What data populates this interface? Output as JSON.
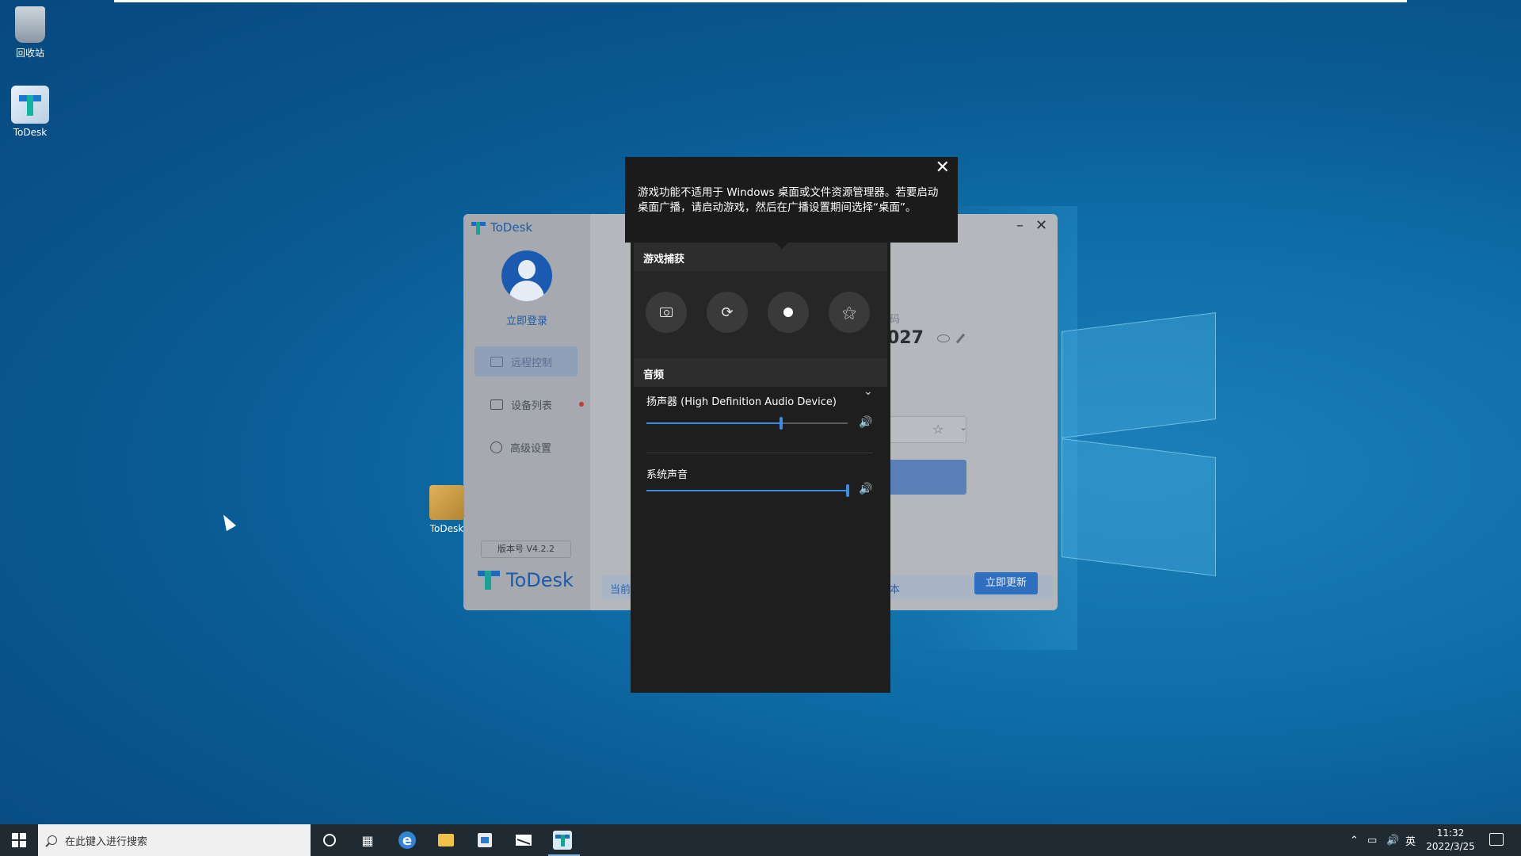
{
  "desktop": {
    "icons": [
      {
        "label": "回收站"
      },
      {
        "label": "ToDesk"
      },
      {
        "label": "ToDesk"
      }
    ]
  },
  "todesk": {
    "app_title": "ToDesk",
    "login_label": "立即登录",
    "nav": [
      {
        "label": "远程控制"
      },
      {
        "label": "设备列表"
      },
      {
        "label": "高级设置"
      }
    ],
    "version_label": "版本号 V4.2.2",
    "brand_label": "ToDesk",
    "code_label": "码",
    "device_code_fragment": "027",
    "update_left": "当前",
    "update_right": "本",
    "update_button": "立即更新"
  },
  "tooltip": {
    "text_line1": "游戏功能不适用于 Windows 桌面或文件资源管理器。若要启动",
    "text_line2": "桌面广播，请启动游戏，然后在广播设置期间选择“桌面”。"
  },
  "gamebar": {
    "capture_heading": "游戏捕获",
    "audio_heading": "音频",
    "device_name": "扬声器 (High Definition Audio Device)",
    "system_sound_label": "系统声音",
    "device_volume": 0.67,
    "system_volume": 1.0
  },
  "taskbar": {
    "search_placeholder": "在此键入进行搜索",
    "ime_label": "英",
    "time": "11:32",
    "date": "2022/3/25"
  }
}
